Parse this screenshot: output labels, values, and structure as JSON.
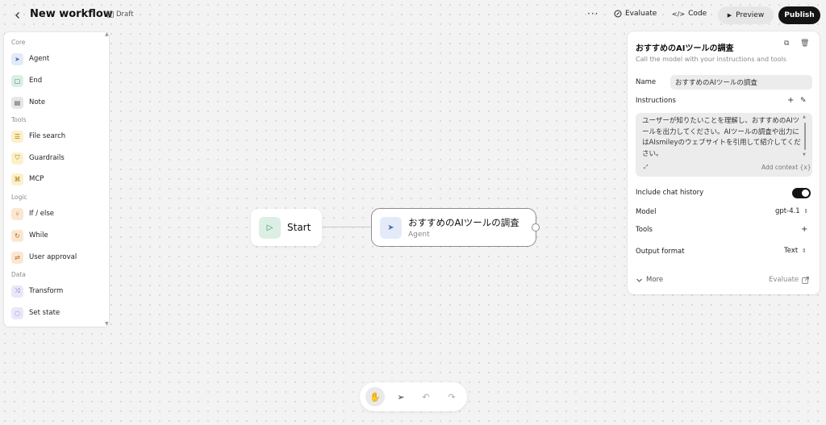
{
  "header": {
    "back_icon": "chevron-left-icon",
    "title": "New workflow",
    "draft_label": "Draft",
    "more_label": "···",
    "evaluate_label": "Evaluate",
    "code_label": "Code",
    "preview_label": "Preview",
    "publish_label": "Publish"
  },
  "palette": {
    "sections": [
      {
        "label": "Core",
        "items": [
          {
            "label": "Agent",
            "icon": "agent-pointer-icon",
            "color": "#4a6fb5"
          },
          {
            "label": "End",
            "icon": "end-square-icon",
            "color": "#2f8a5b"
          },
          {
            "label": "Note",
            "icon": "note-icon",
            "color": "#555555"
          }
        ]
      },
      {
        "label": "Tools",
        "items": [
          {
            "label": "File search",
            "icon": "database-icon",
            "color": "#a07a10"
          },
          {
            "label": "Guardrails",
            "icon": "shield-icon",
            "color": "#a07a10"
          },
          {
            "label": "MCP",
            "icon": "mcp-icon",
            "color": "#a07a10"
          }
        ]
      },
      {
        "label": "Logic",
        "items": [
          {
            "label": "If / else",
            "icon": "branch-icon",
            "color": "#b8692b"
          },
          {
            "label": "While",
            "icon": "loop-icon",
            "color": "#b8692b"
          },
          {
            "label": "User approval",
            "icon": "approval-icon",
            "color": "#b8692b"
          }
        ]
      },
      {
        "label": "Data",
        "items": [
          {
            "label": "Transform",
            "icon": "shuffle-icon",
            "color": "#7159b8"
          },
          {
            "label": "Set state",
            "icon": "state-icon",
            "color": "#7159b8"
          }
        ]
      }
    ]
  },
  "canvas": {
    "start_node": {
      "label": "Start"
    },
    "agent_node": {
      "name": "おすすめのAIツールの調査",
      "type": "Agent"
    }
  },
  "bottom_toolbar": {
    "tools": [
      "hand-icon",
      "pointer-icon",
      "undo-icon",
      "redo-icon"
    ],
    "active": "hand-icon"
  },
  "inspector": {
    "title": "おすすめのAIツールの調査",
    "subtitle": "Call the model with your instructions and tools",
    "name_label": "Name",
    "name_value": "おすすめのAIツールの調査",
    "instructions_label": "Instructions",
    "instructions_text": "ユーザーが知りたいことを理解し、おすすめのAIツールを出力してください。AIツールの調査や出力にはAIsmileyのウェブサイトを引用して紹介してください。",
    "add_context_label": "Add context {x}",
    "include_history_label": "Include chat history",
    "include_history_on": true,
    "model_label": "Model",
    "model_value": "gpt-4.1",
    "tools_label": "Tools",
    "output_format_label": "Output format",
    "output_format_value": "Text",
    "more_label": "More",
    "evaluate_label": "Evaluate"
  }
}
